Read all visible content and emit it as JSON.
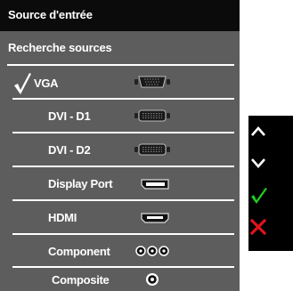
{
  "osd": {
    "title": "Source d'entrée",
    "section_label": "Recherche sources",
    "selected_source": "VGA",
    "sources": [
      {
        "label": "VGA",
        "icon": "vga-port-icon"
      },
      {
        "label": "DVI - D1",
        "icon": "dvi-port-icon"
      },
      {
        "label": "DVI - D2",
        "icon": "dvi-port-icon"
      },
      {
        "label": "Display Port",
        "icon": "displayport-icon"
      },
      {
        "label": "HDMI",
        "icon": "hdmi-port-icon"
      },
      {
        "label": "Component",
        "icon": "component-port-icon"
      },
      {
        "label": "Composite",
        "icon": "composite-port-icon"
      }
    ]
  },
  "legend": {
    "buttons": [
      {
        "icon": "up-arrow-icon"
      },
      {
        "icon": "down-arrow-icon"
      },
      {
        "icon": "confirm-check-icon",
        "color": "#1fcc1f"
      },
      {
        "icon": "exit-x-icon",
        "color": "#e0141a"
      }
    ]
  },
  "colors": {
    "panel": "#5d5d5d",
    "header": "#0b0b0b",
    "text": "#ffffff"
  }
}
